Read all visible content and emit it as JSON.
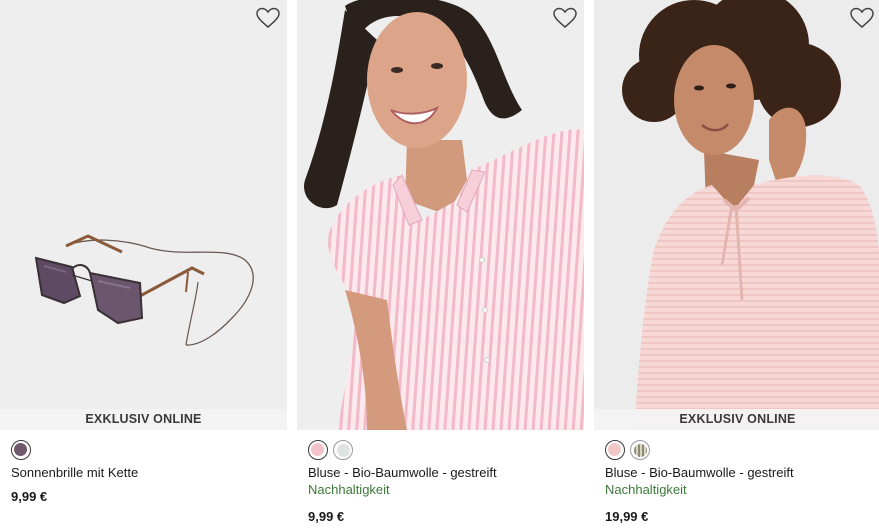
{
  "products": [
    {
      "name": "Sonnenbrille mit Kette",
      "badge": "EXKLUSIV ONLINE",
      "sustainability": "",
      "price": "9,99 €",
      "wishlist_icon": "heart-outline-icon",
      "image": "sunglasses-with-chain",
      "swatches": [
        {
          "color": "#6e5a6c",
          "selected": true
        }
      ]
    },
    {
      "name": "Bluse - Bio-Baumwolle - gestreift",
      "badge": "",
      "sustainability": "Nachhaltigkeit",
      "price": "9,99 €",
      "wishlist_icon": "heart-outline-icon",
      "image": "woman-pink-striped-blouse",
      "swatches": [
        {
          "color": "#f2c2cb",
          "selected": true
        },
        {
          "color": "#dfe3e3",
          "selected": false
        }
      ]
    },
    {
      "name": "Bluse - Bio-Baumwolle - gestreift",
      "badge": "EXKLUSIV ONLINE",
      "sustainability": "Nachhaltigkeit",
      "price": "19,99 €",
      "wishlist_icon": "heart-outline-icon",
      "image": "woman-pink-tie-neck-blouse",
      "swatches": [
        {
          "color": "#f0c8c8",
          "selected": true
        },
        {
          "color": "#8c8a72",
          "selected": false
        }
      ]
    }
  ],
  "colors": {
    "sustainability_text": "#3d7a3a",
    "badge_background": "#f3f3f3"
  }
}
